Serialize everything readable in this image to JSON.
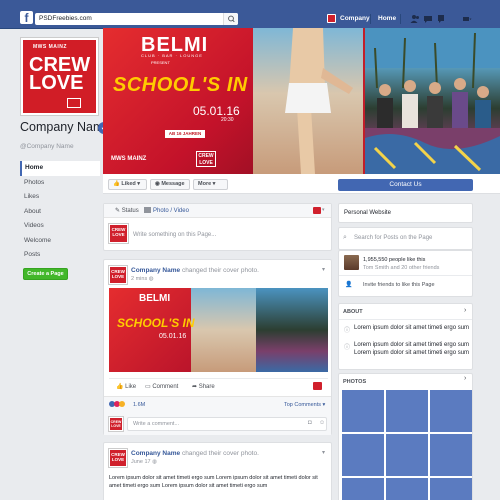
{
  "topbar": {
    "search_value": "PSDFreebies.com",
    "profile_name": "Company",
    "home_label": "Home",
    "icons": [
      "facebook-logo-icon",
      "search-icon",
      "friend-requests-icon",
      "messages-icon",
      "notifications-icon",
      "account-menu-icon"
    ]
  },
  "profile": {
    "pic_top_text": "MWS MAINZ",
    "pic_crew": "CREW",
    "pic_love": "LOVE",
    "name": "Company Name",
    "handle": "@Company Name"
  },
  "sidebar": {
    "items": [
      {
        "label": "Home",
        "active": true
      },
      {
        "label": "Photos"
      },
      {
        "label": "Likes"
      },
      {
        "label": "About"
      },
      {
        "label": "Videos"
      },
      {
        "label": "Welcome"
      },
      {
        "label": "Posts"
      }
    ],
    "create_page": "Create a Page"
  },
  "cover": {
    "brand": "BELMI",
    "brand_sub": "CLUB · BAR · LOUNGE",
    "present": "PRESENT",
    "headline": "SCHOOL'S IN",
    "date": "05.01.16",
    "time": "20:30",
    "age": "AB 16 JAHREN",
    "footer_left": "MWS MAINZ",
    "crew": "CREW",
    "love": "LOVE"
  },
  "actions": {
    "liked": "Liked",
    "message": "Message",
    "more": "More",
    "contact": "Contact Us"
  },
  "composer": {
    "status": "Status",
    "photo_video": "Photo / Video",
    "placeholder": "Write something on this Page..."
  },
  "post1": {
    "author": "Company Name",
    "action": "changed their cover photo.",
    "time": "2 mins",
    "like": "Like",
    "comment": "Comment",
    "share": "Share",
    "reactions_count": "1.6M",
    "top_comments": "Top Comments",
    "comment_placeholder": "Write a comment..."
  },
  "post2": {
    "author": "Company Name",
    "action": "changed their cover photo.",
    "time": "June 17",
    "text": "Lorem ipsum dolor sit amet timeti ergo sum Lorem ipsum dolor sit amet timeti dolor sit amet timeti ergo sum Lorem ipsum dolor sit amet timeti ergo sum"
  },
  "right": {
    "website": "Personal Website",
    "search_placeholder": "Search for Posts on the Page",
    "likes_line": "1,955,550 people like this",
    "likes_friends": "Tom Smith and 20 other friends",
    "invite": "Invite friends to like this Page",
    "about_title": "ABOUT",
    "about_1": "Lorem ipsum dolor sit amet timeti ergo sum",
    "about_2": "Lorem ipsum dolor sit amet timeti ergo sum Lorem ipsum dolor sit amet timeti ergo sum",
    "photos_title": "PHOTOS"
  },
  "colors": {
    "brand_blue": "#3b5998",
    "button_blue": "#4267b2",
    "logo_red": "#d0202c",
    "create_green": "#42b72a",
    "photo_tile": "#5b7bc0"
  }
}
